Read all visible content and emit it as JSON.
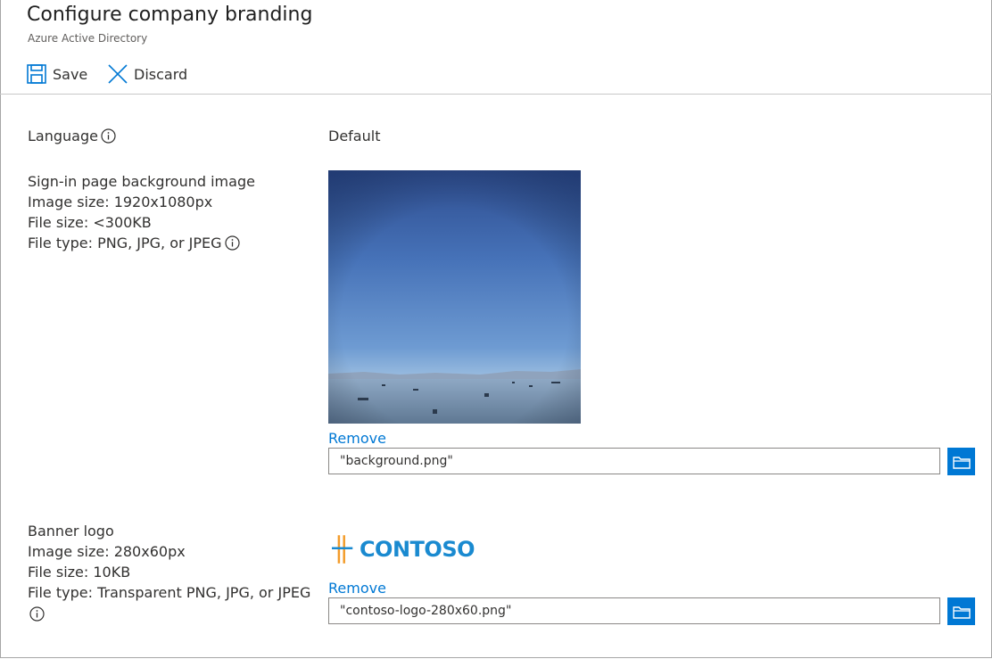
{
  "header": {
    "title": "Configure company branding",
    "subtitle": "Azure Active Directory"
  },
  "toolbar": {
    "save_label": "Save",
    "discard_label": "Discard"
  },
  "language": {
    "label": "Language",
    "value": "Default"
  },
  "background_image": {
    "title": "Sign-in page background image",
    "image_size": "Image size: 1920x1080px",
    "file_size": "File size: <300KB",
    "file_type": "File type: PNG, JPG, or JPEG",
    "remove_label": "Remove",
    "file_value": "\"background.png\""
  },
  "banner_logo": {
    "title": "Banner logo",
    "image_size": "Image size: 280x60px",
    "file_size": "File size: 10KB",
    "file_type": "File type: Transparent PNG, JPG, or JPEG",
    "logo_text": "CONTOSO",
    "remove_label": "Remove",
    "file_value": "\"contoso-logo-280x60.png\""
  },
  "icons": {
    "save": "save-icon",
    "discard": "close-icon",
    "info": "info-icon",
    "browse": "folder-icon"
  },
  "colors": {
    "accent": "#0078d4",
    "logo_orange": "#f39c2b",
    "logo_blue": "#1a8ad0"
  }
}
